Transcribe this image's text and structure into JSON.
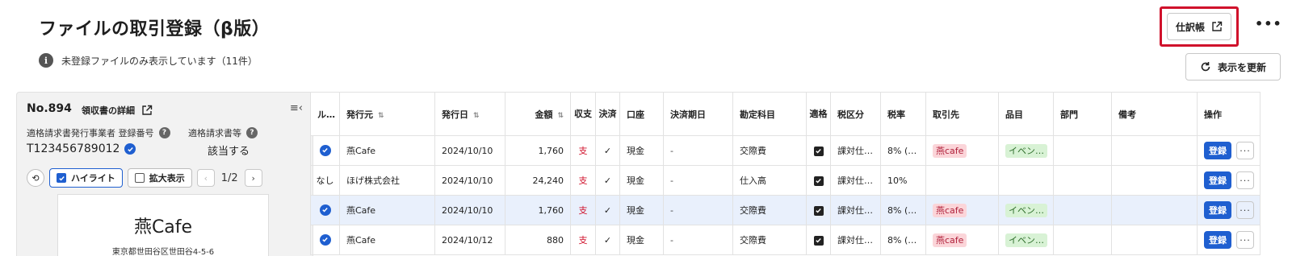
{
  "header": {
    "title": "ファイルの取引登録（β版）",
    "notice": "未登録ファイルのみ表示しています（11件）",
    "journal_label": "仕訳帳",
    "more_label": "•••",
    "refresh_label": "表示を更新"
  },
  "panel": {
    "number": "No.894",
    "detail_label": "領収書の詳細",
    "issuer_reg_label": "適格請求書発行事業者 登録番号",
    "invoice_label": "適格請求書等",
    "reg_number": "T123456789012",
    "invoice_value": "該当する",
    "highlight_label": "ハイライト",
    "zoom_label": "拡大表示",
    "page_indicator": "1/2",
    "receipt_store": "燕Cafe",
    "receipt_address": "東京都世田谷区世田谷4-5-6"
  },
  "table": {
    "headers": {
      "rule": "ル…",
      "issuer": "発行元",
      "date": "発行日",
      "amount": "金額",
      "inout": "収支",
      "settled": "決済",
      "account": "口座",
      "due": "決済期日",
      "subject": "勘定科目",
      "qualified": "適格",
      "taxcat": "税区分",
      "rate": "税率",
      "partner": "取引先",
      "item": "品目",
      "dept": "部門",
      "memo": "備考",
      "action": "操作"
    },
    "rows": [
      {
        "rule": "",
        "issuer": "燕Cafe",
        "date": "2024/10/10",
        "amount": "1,760",
        "inout": "支",
        "account": "現金",
        "due": "-",
        "subject": "交際費",
        "taxcat": "課対仕…",
        "rate": "8% (…",
        "partner": "燕cafe",
        "item": "イベン…",
        "register": "登録"
      },
      {
        "rule": "なし",
        "issuer": "ほげ株式会社",
        "date": "2024/10/10",
        "amount": "24,240",
        "inout": "支",
        "account": "現金",
        "due": "-",
        "subject": "仕入高",
        "taxcat": "課対仕…",
        "rate": "10%",
        "partner": "",
        "item": "",
        "register": "登録"
      },
      {
        "rule": "",
        "issuer": "燕Cafe",
        "date": "2024/10/10",
        "amount": "1,760",
        "inout": "支",
        "account": "現金",
        "due": "-",
        "subject": "交際費",
        "taxcat": "課対仕…",
        "rate": "8% (…",
        "partner": "燕cafe",
        "item": "イベン…",
        "register": "登録"
      },
      {
        "rule": "",
        "issuer": "燕Cafe",
        "date": "2024/10/12",
        "amount": "880",
        "inout": "支",
        "account": "現金",
        "due": "-",
        "subject": "交際費",
        "taxcat": "課対仕…",
        "rate": "8% (…",
        "partner": "燕cafe",
        "item": "イベン…",
        "register": "登録"
      }
    ]
  }
}
